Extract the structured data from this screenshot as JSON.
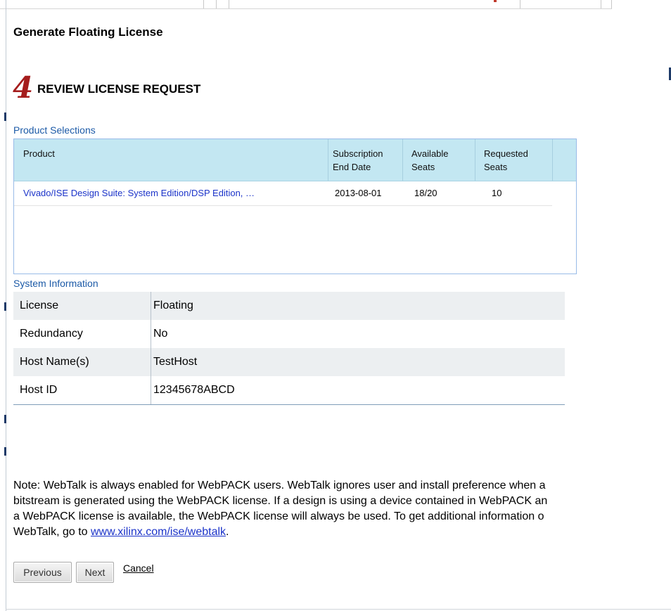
{
  "dialog": {
    "title": "Generate Floating License"
  },
  "step": {
    "number": "4",
    "heading": "REVIEW LICENSE REQUEST"
  },
  "product_selections": {
    "label": "Product Selections",
    "columns": {
      "product": "Product",
      "subscription_l1": "Subscription",
      "subscription_l2": "End Date",
      "available_l1": "Available",
      "available_l2": "Seats",
      "requested_l1": "Requested",
      "requested_l2": "Seats"
    },
    "rows": [
      {
        "product": "Vivado/ISE Design Suite: System Edition/DSP Edition, …",
        "end_date": "2013-08-01",
        "available": "18/20",
        "requested": "10"
      }
    ]
  },
  "system_information": {
    "label": "System Information",
    "rows": [
      {
        "key": "License",
        "value": "Floating"
      },
      {
        "key": "Redundancy",
        "value": "No"
      },
      {
        "key": "Host Name(s)",
        "value": "TestHost"
      },
      {
        "key": "Host ID",
        "value": "12345678ABCD"
      }
    ]
  },
  "note": {
    "line1": "Note: WebTalk is always enabled for WebPACK users. WebTalk ignores user and install preference when a",
    "line2": "bitstream is generated using the WebPACK license. If a design is using a device contained in WebPACK an",
    "line3": "a WebPACK license is available, the WebPACK license will always be used. To get additional information o",
    "line4_prefix": "WebTalk, go to ",
    "link": "www.xilinx.com/ise/webtalk",
    "line4_suffix": "."
  },
  "buttons": {
    "previous": "Previous",
    "next": "Next",
    "cancel": "Cancel"
  },
  "colors": {
    "accent_link": "#1b33c9",
    "section_label": "#1c5aa7",
    "step_number": "#a51d1d",
    "table_header": "#c3e7f2"
  }
}
